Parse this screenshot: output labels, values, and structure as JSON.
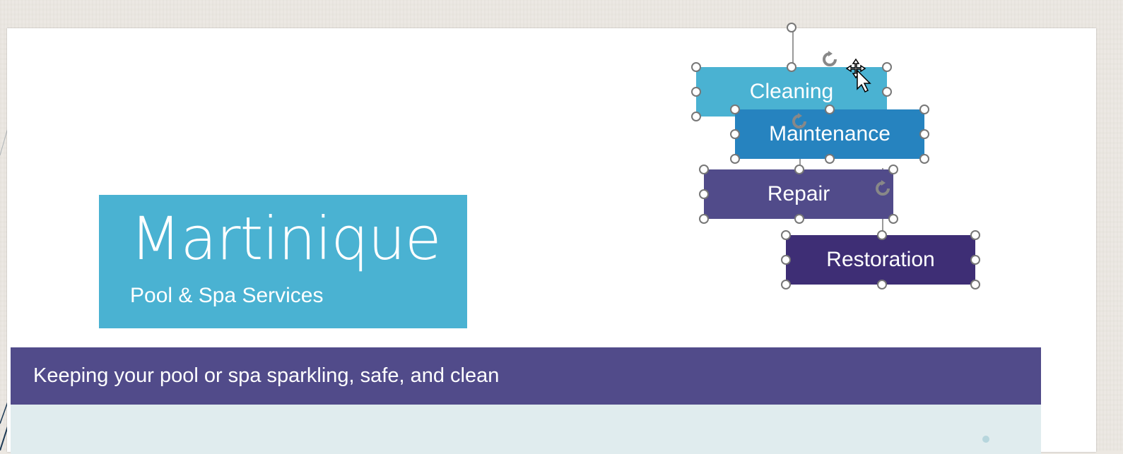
{
  "document": {
    "title_main": "Martinique",
    "title_sub": "Pool & Spa Services",
    "band_text": "Keeping your pool or spa sparkling, safe, and clean"
  },
  "shapes": [
    {
      "label": "Cleaning",
      "color": "#4ab2d2"
    },
    {
      "label": "Maintenance",
      "color": "#2683bf"
    },
    {
      "label": "Repair",
      "color": "#514b8a"
    },
    {
      "label": "Restoration",
      "color": "#3e2e75"
    }
  ],
  "colors": {
    "title_box": "#4ab2d2",
    "band": "#514b8a",
    "band_lower": "#e0ecee"
  },
  "icons": {
    "cursor": "move-cursor-icon",
    "rotate": "rotate-handle-icon"
  }
}
